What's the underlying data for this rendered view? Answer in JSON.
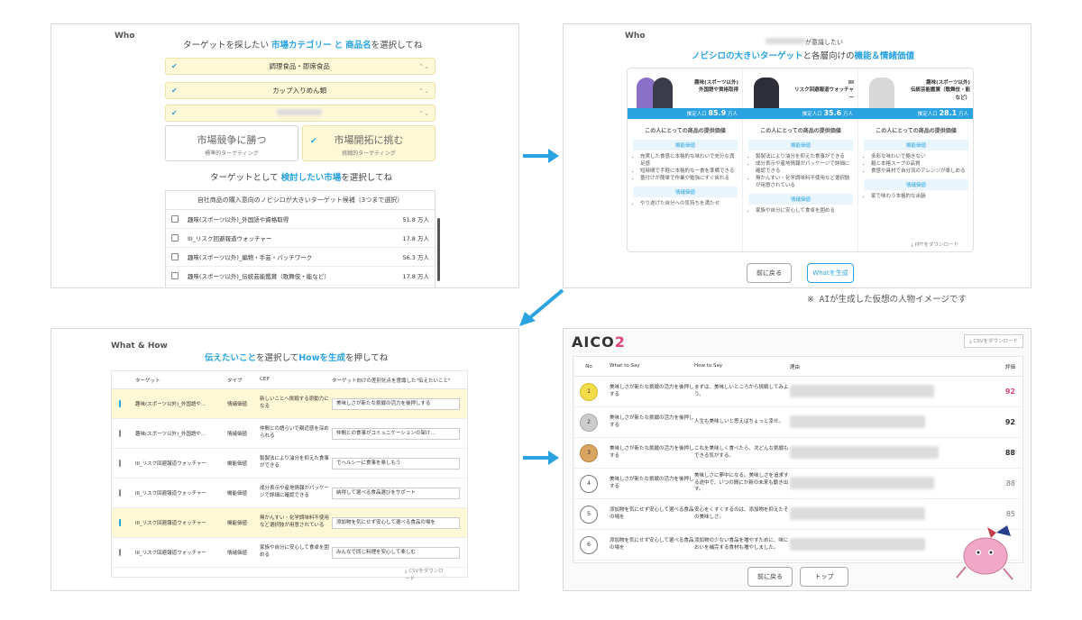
{
  "who_label": "Who",
  "what_how_label": "What & How",
  "p1": {
    "heading_pre": "ターゲットを探したい",
    "heading_hl1": "市場カテゴリー",
    "heading_mid": "と",
    "heading_hl2": "商品名",
    "heading_post": "を選択してね",
    "selects": [
      "調理食品・即席食品",
      "カップ入りめん類",
      ""
    ],
    "seg_left_big": "市場競争に勝つ",
    "seg_left_small": "標準的ターゲティング",
    "seg_right_big": "市場開拓に挑む",
    "seg_right_small": "挑戦的ターゲティング",
    "heading2_pre": "ターゲットとして",
    "heading2_hl": "検討したい市場",
    "heading2_post": "を選択してね",
    "list_header": "自社商品の購入意向のノビシロが大きいターゲット候補（3つまで選択）",
    "rows": [
      {
        "name": "趣味(スポーツ以外)_外国語や資格取得",
        "value": "51.8 万人"
      },
      {
        "name": "III_リスク回避報道ウォッチャー",
        "value": "17.8 万人"
      },
      {
        "name": "趣味(スポーツ以外)_編物・手芸・パッチワーク",
        "value": "56.3 万人"
      },
      {
        "name": "趣味(スポーツ以外)_伝統芸能鑑賞（歌舞伎・能など）",
        "value": "17.8 万人"
      }
    ]
  },
  "p2": {
    "heading_top": "が意識したい",
    "heading_hl1": "ノビシロの大きいターゲット",
    "heading_mid": "と各層向けの",
    "heading_hl2": "機能＆情緒価値",
    "columns": [
      {
        "title": "趣味(スポーツ以外)\n外国語や資格取得",
        "pop_label": "推定人口",
        "pop": "85.9",
        "unit": "万人",
        "value_title": "この人にとっての商品の提供価値",
        "chip1": "機能価値",
        "items": [
          "充実した食感と本格的な味わいで充分な満足感",
          "短時間で手軽に本格的な一食を準備できる",
          "蓋付けが簡単で作業や勉強にすぐ戻れる"
        ],
        "chip2": "情緒価値",
        "item2": "やり遂げた自分への気持ちを満たせ"
      },
      {
        "title": "III\nリスク回避報道ウォッチャー",
        "pop_label": "推定人口",
        "pop": "35.6",
        "unit": "万人",
        "value_title": "この人にとっての商品の提供価値",
        "chip1": "機能価値",
        "items": [
          "製製法により油分を抑えた食事ができる",
          "成分表示や産地情報がパッケージで詳細に確認できる",
          "無かんすい・化学調味料不使用など選択肢が用意されている"
        ],
        "chip2": "情緒価値",
        "item2": "家族や自分に安心して食卓を囲める"
      },
      {
        "title": "趣味(スポーツ以外)\n伝統芸能鑑賞（歌舞伎・能など）",
        "pop_label": "推定人口",
        "pop": "28.1",
        "unit": "万人",
        "value_title": "この人にとっての商品の提供価値",
        "chip1": "機能価値",
        "items": [
          "多彩な味わいで飽きない",
          "麺と本格スープの品質",
          "食感や具材で自分流のアレンジが楽しめる"
        ],
        "chip2": "情緒価値",
        "item2": "家で味わう本格的な余韻"
      }
    ],
    "ppt_download": "PPTをダウンロード",
    "back": "前に戻る",
    "generate": "Whatを生成",
    "caption": "※ AIが生成した仮想の人物イメージです"
  },
  "p3": {
    "heading_hl1": "伝えたいこと",
    "heading_mid": "を選択して",
    "heading_hl2": "Howを生成",
    "heading_post": "を押してね",
    "cols": [
      "ターゲット",
      "タイプ",
      "CEP",
      "ターゲット向けの差別化点を意識した\"伝えたいこと\""
    ],
    "rows": [
      {
        "checked": true,
        "target": "趣味(スポーツ以外)_外国語や…",
        "type": "情緒価値",
        "cep": "新しいことへ挑戦する原動力になる",
        "msg": "美味しさが新たな挑戦の活力を後押しする"
      },
      {
        "checked": false,
        "target": "趣味(スポーツ以外)_外国語や…",
        "type": "情緒価値",
        "cep": "仲間との語らいで親近感を深められる",
        "msg": "仲間との食事がコミュニケーションの架け…"
      },
      {
        "checked": false,
        "target": "III_リスク回避報道ウォッチャー",
        "type": "機能価値",
        "cep": "製製法により油分を抑えた食事ができる",
        "msg": "でヘルシーに食事を楽しもう"
      },
      {
        "checked": false,
        "target": "III_リスク回避報道ウォッチャー",
        "type": "機能価値",
        "cep": "成分表示や産地情報がパッケージで詳細に確認できる",
        "msg": "納得して選べる食品選びをサポート"
      },
      {
        "checked": true,
        "target": "III_リスク回避報道ウォッチャー",
        "type": "機能価値",
        "cep": "無かんすい・化学調味料不使用など選択肢が用意されている",
        "msg": "添加物を気にせず安心して選べる食品の場を"
      },
      {
        "checked": false,
        "target": "III_リスク回避報道ウォッチャー",
        "type": "情緒価値",
        "cep": "家族や自分に安心して食卓を囲める",
        "msg": "みんなで同じ料理を安心して楽しむ"
      }
    ],
    "csv": "CSVをダウンロード"
  },
  "p4": {
    "logo_a": "AICO",
    "logo_b": "2",
    "csv": "CSVをダウンロード",
    "cols": [
      "No",
      "What to Say",
      "How to Say",
      "理由",
      "評価"
    ],
    "rows": [
      {
        "no": "1",
        "what": "美味しさが新たな挑戦の活力を後押しする",
        "how": "まずは、美味しいところから挑戦してみよう。",
        "score": "92"
      },
      {
        "no": "2",
        "what": "美味しさが新たな挑戦の活力を後押しする",
        "how": "人生も美味しいと思えばちょっと幸せ。",
        "score": "92"
      },
      {
        "no": "3",
        "what": "美味しさが新たな挑戦の活力を後押しする",
        "how": "これを美味しく食べたら、次どんな挑戦もできる気がする。",
        "score": "88"
      },
      {
        "no": "4",
        "what": "美味しさが新たな挑戦の活力を後押しする",
        "how": "美味しさに夢中になる。美味しさを追求する途中で、いつの間にか新の未来も動き出す。",
        "score": "88"
      },
      {
        "no": "5",
        "what": "添加物を気にせず安心して選べる食品の場を",
        "how": "安心をくすくするのは、添加物を抑えたその美味しさ。",
        "score": "85"
      },
      {
        "no": "6",
        "what": "添加物を気にせず安心して選べる食品の場を",
        "how": "添加物の少ない食品を増やすために、味においを補完する食材も増やしました。",
        "score": ""
      }
    ],
    "back": "前に戻る",
    "top": "トップ"
  },
  "colors": {
    "accent": "#2aa3e0",
    "highlight": "#fff8d6",
    "score_top": "#e0457b",
    "gold": "#f2dc4a",
    "silver": "#cccccc",
    "bronze": "#d9a561"
  }
}
